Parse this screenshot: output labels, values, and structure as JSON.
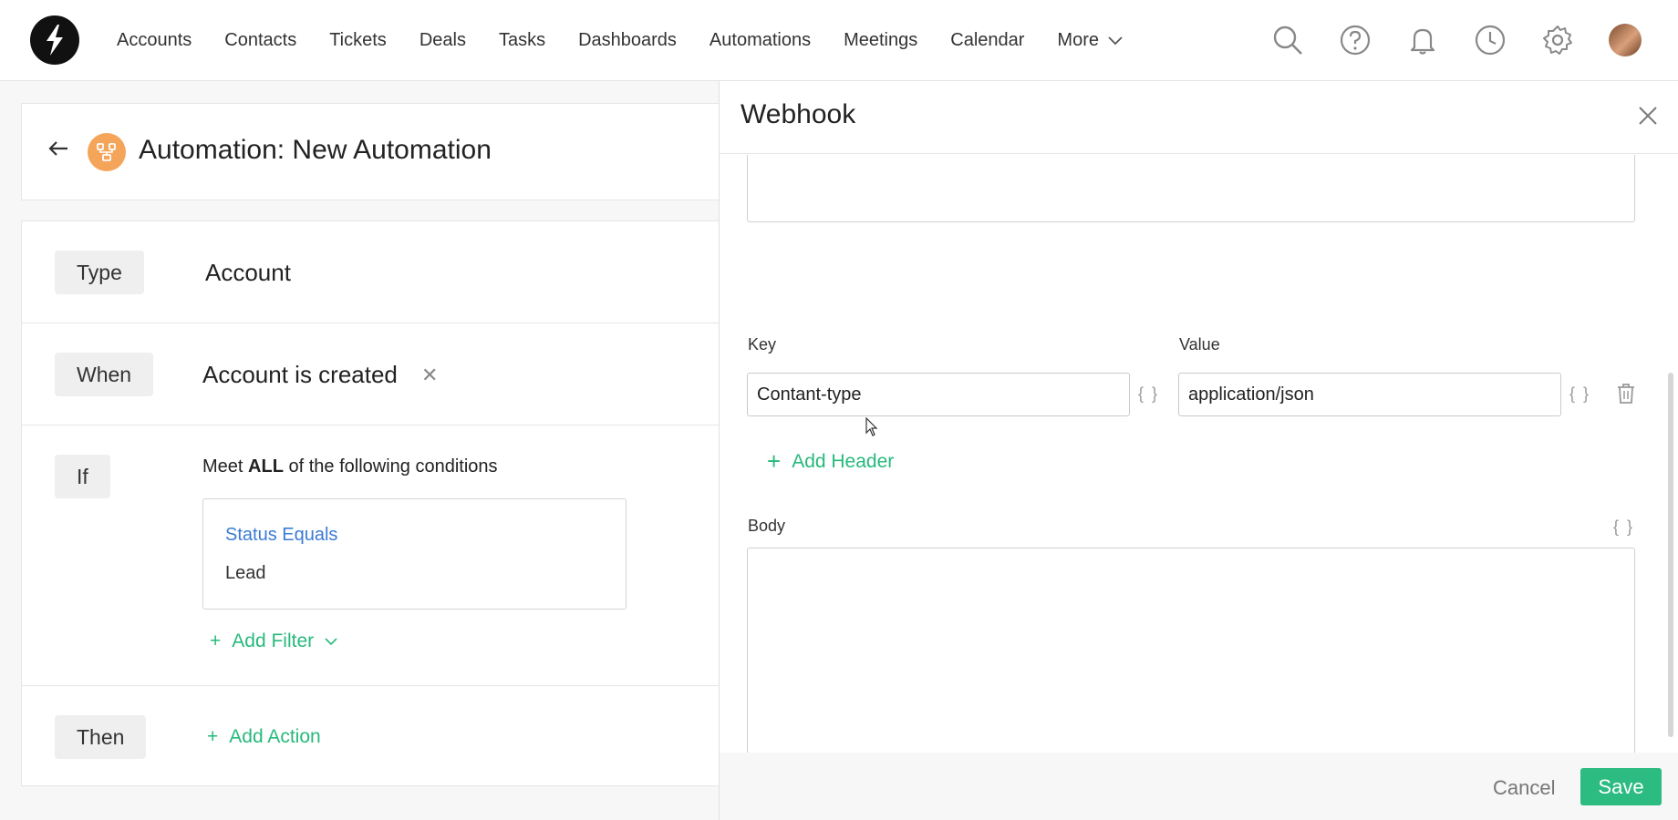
{
  "nav": {
    "items": [
      "Accounts",
      "Contacts",
      "Tickets",
      "Deals",
      "Tasks",
      "Dashboards",
      "Automations",
      "Meetings",
      "Calendar"
    ],
    "more_label": "More"
  },
  "page": {
    "title": "Automation: New Automation"
  },
  "rules": {
    "type_label": "Type",
    "type_value": "Account",
    "when_label": "When",
    "when_value": "Account is created",
    "if_label": "If",
    "meet_prefix": "Meet ",
    "meet_bold": "ALL",
    "meet_suffix": " of the following conditions",
    "condition_title": "Status Equals",
    "condition_value": "Lead",
    "add_filter": "Add Filter",
    "then_label": "Then",
    "add_action": "Add Action"
  },
  "webhook": {
    "title": "Webhook",
    "key_label": "Key",
    "value_label": "Value",
    "header_key": "Contant-type",
    "header_value": "application/json",
    "braces": "{ }",
    "add_header": "Add Header",
    "body_label": "Body",
    "cancel": "Cancel",
    "save": "Save"
  },
  "colors": {
    "accent_green": "#2cbb81",
    "link_blue": "#3a7bd5",
    "automation_icon": "#f5a55a"
  }
}
